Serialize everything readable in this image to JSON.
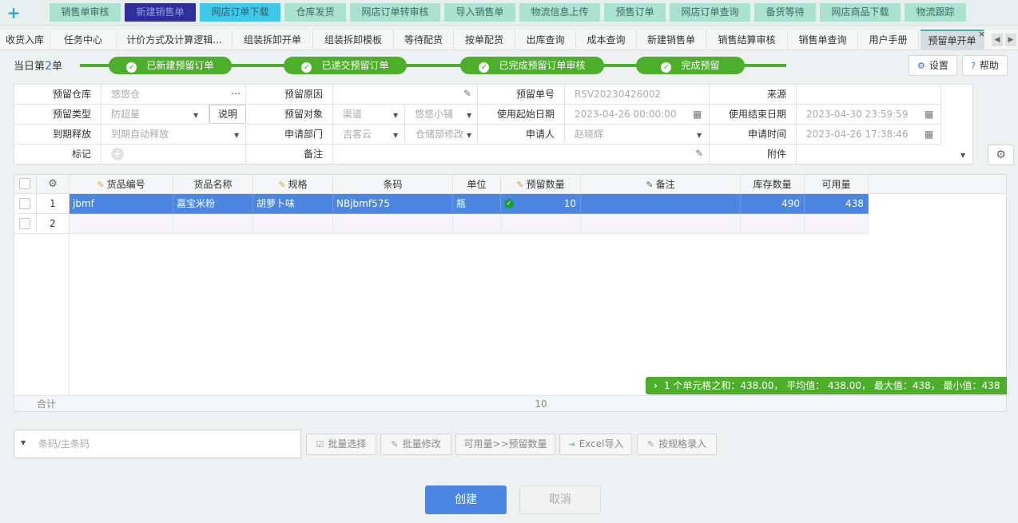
{
  "quick_nav": {
    "items": [
      "销售单审核",
      "新建销售单",
      "网店订单下载",
      "仓库发货",
      "网店订单转审核",
      "导入销售单",
      "物流信息上传",
      "预售订单",
      "网店订单查询",
      "备货等待",
      "网店商品下载",
      "物流跟踪"
    ]
  },
  "tabs": {
    "items": [
      "收货入库",
      "任务中心",
      "计价方式及计算逻辑...",
      "组装拆卸开单",
      "组装拆卸模板",
      "等待配货",
      "按单配货",
      "出库查询",
      "成本查询",
      "新建销售单",
      "销售结算审核",
      "销售单查询",
      "用户手册",
      "预留单开单"
    ],
    "close": "×"
  },
  "header": {
    "count_prefix": "当日第",
    "count_num": "2",
    "count_suffix": "单",
    "steps": [
      "已新建预留订单",
      "已递交预留订单",
      "已完成预留订单审核",
      "完成预留"
    ],
    "settings": "设置",
    "help": "帮助"
  },
  "form": {
    "warehouse_label": "预留仓库",
    "warehouse_value": "悠悠仓",
    "reason_label": "预留原因",
    "reason_value": "",
    "order_no_label": "预留单号",
    "order_no_value": "RSV20230426002",
    "source_label": "来源",
    "source_value": "",
    "type_label": "预留类型",
    "type_value": "防超量",
    "explain_button": "说明",
    "target_label": "预留对象",
    "target_channel": "渠道",
    "target_shop": "悠悠小铺",
    "start_label": "使用起始日期",
    "start_value": "2023-04-26 00:00:00",
    "end_label": "使用结束日期",
    "end_value": "2023-04-30 23:59:59",
    "release_label": "到期释放",
    "release_value": "到期自动释放",
    "dept_label": "申请部门",
    "dept_value": "吉客云",
    "dept_sub": "仓储部修改",
    "applicant_label": "申请人",
    "applicant_value": "赵晓辉",
    "apply_time_label": "申请时间",
    "apply_time_value": "2023-04-26 17:38:46",
    "tag_label": "标记",
    "remark_label": "备注",
    "remark_value": "",
    "attach_label": "附件",
    "attach_value": ""
  },
  "grid": {
    "columns": [
      "货品编号",
      "货品名称",
      "规格",
      "条码",
      "单位",
      "预留数量",
      "备注",
      "库存数量",
      "可用量"
    ],
    "rows": [
      {
        "no": "1",
        "code": "jbmf",
        "name": "嘉宝米粉",
        "spec": "胡萝卜味",
        "barcode": "NBjbmf575",
        "unit": "瓶",
        "qty": "10",
        "remark": "",
        "stock": "490",
        "avail": "438"
      },
      {
        "no": "2",
        "code": "",
        "name": "",
        "spec": "",
        "barcode": "",
        "unit": "",
        "qty": "",
        "remark": "",
        "stock": "",
        "avail": ""
      }
    ],
    "total_label": "合计",
    "total_qty": "10",
    "stats": "1 个单元格之和：438.00， 平均值： 438.00， 最大值：438， 最小值：438"
  },
  "toolbar": {
    "scan_placeholder": "条码/主条码",
    "batch_select": "批量选择",
    "batch_edit": "批量修改",
    "avail_to_qty": "可用量>>预留数量",
    "excel_import": "Excel导入",
    "spec_entry": "按规格录入"
  },
  "actions": {
    "create": "创建",
    "cancel": "取消"
  },
  "colors": {
    "accent_blue": "#4b86e2",
    "progress_green": "#4caf2a",
    "quick_nav_mint": "#a9e3cf"
  }
}
